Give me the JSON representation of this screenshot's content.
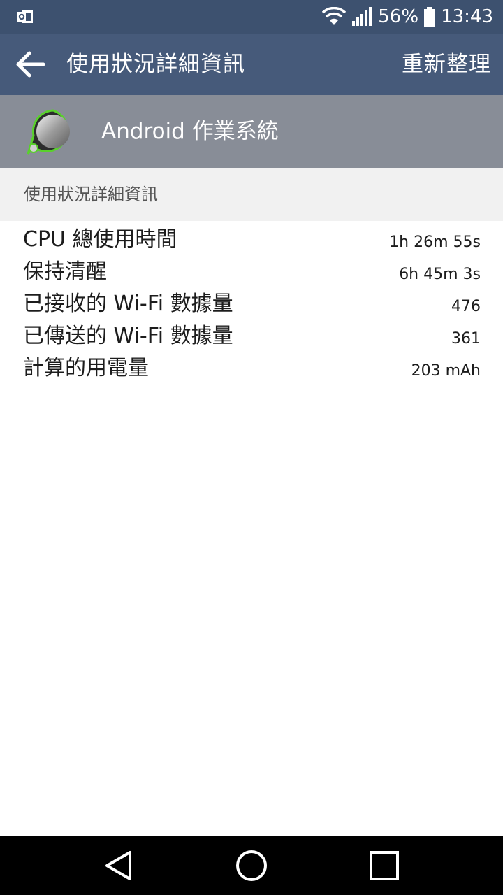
{
  "status_bar": {
    "notification_icon": "outlook-icon",
    "wifi_icon": "wifi-icon",
    "signal_icon": "signal-icon",
    "battery_percent": "56%",
    "battery_icon": "battery-icon",
    "time": "13:43"
  },
  "app_bar": {
    "back_icon": "arrow-left-icon",
    "title": "使用狀況詳細資訊",
    "refresh_label": "重新整理"
  },
  "app_header": {
    "icon": "android-os-icon",
    "name": "Android 作業系統"
  },
  "section": {
    "title": "使用狀況詳細資訊"
  },
  "details": [
    {
      "label": "CPU 總使用時間",
      "value": "1h 26m 55s"
    },
    {
      "label": "保持清醒",
      "value": "6h 45m 3s"
    },
    {
      "label": "已接收的 Wi-Fi 數據量",
      "value": "476"
    },
    {
      "label": "已傳送的 Wi-Fi 數據量",
      "value": "361"
    },
    {
      "label": "計算的用電量",
      "value": "203 mAh"
    }
  ],
  "nav_bar": {
    "back": "back-triangle-icon",
    "home": "home-circle-icon",
    "recents": "recents-square-icon"
  },
  "colors": {
    "status_bar": "#3d516f",
    "app_bar": "#465a7a",
    "app_header": "#888d97",
    "section_bg": "#f1f1f1"
  }
}
